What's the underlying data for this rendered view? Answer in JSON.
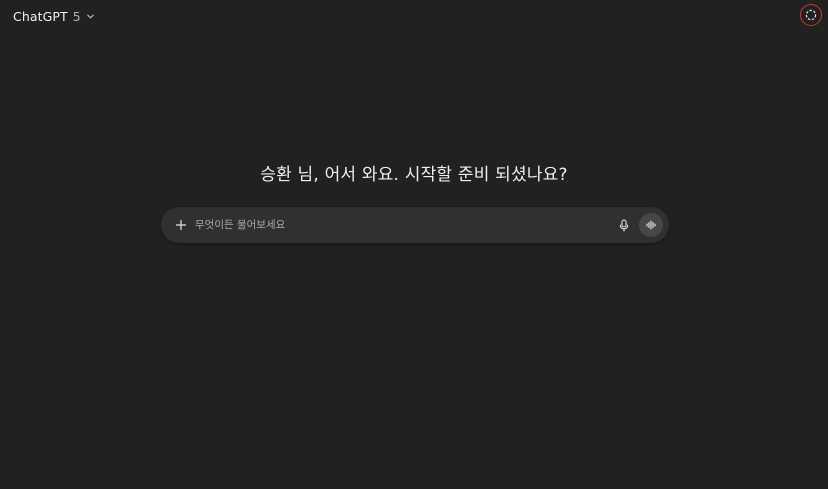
{
  "header": {
    "model_name": "ChatGPT",
    "model_version": "5"
  },
  "main": {
    "greeting": "승환 님, 어서 와요. 시작할 준비 되셨나요?"
  },
  "composer": {
    "placeholder": "무엇이든 물어보세요"
  },
  "icons": {
    "model_dropdown": "chevron-down-icon",
    "temporary_chat": "dashed-circle-icon",
    "add": "plus-icon",
    "dictate": "microphone-icon",
    "voice_mode": "waveform-icon"
  },
  "colors": {
    "background": "#212121",
    "composer_background": "#303030",
    "voice_button_background": "#474747",
    "highlight_ring": "#d6352c"
  }
}
